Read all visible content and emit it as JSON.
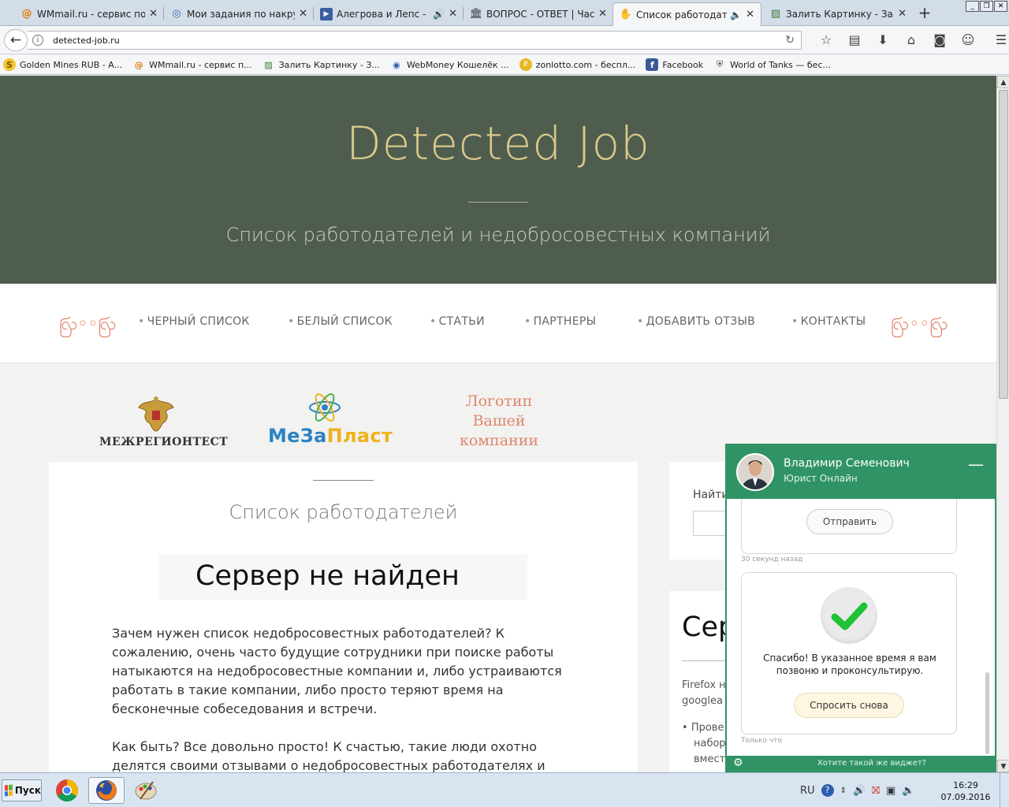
{
  "browser": {
    "tabs": [
      {
        "title": "WMmail.ru - сервис почт...",
        "icon": "at-icon"
      },
      {
        "title": "Мои задания по накрутке",
        "icon": "spiral-icon"
      },
      {
        "title": "Алегрова и Лепс - Я...",
        "icon": "play-icon"
      },
      {
        "title": "ВОПРОС - ОТВЕТ | Част...",
        "icon": "building-icon"
      },
      {
        "title": "Список работодате...",
        "icon": "hand-icon"
      },
      {
        "title": "Залить Картинку - Загр...",
        "icon": "image-icon"
      }
    ],
    "new_tab": "+",
    "url": "detected-job.ru",
    "bookmarks": [
      {
        "label": "Golden Mines RUB - A..."
      },
      {
        "label": "WMmail.ru - сервис п..."
      },
      {
        "label": "Залить Картинку - З..."
      },
      {
        "label": "WebMoney Кошелёк ..."
      },
      {
        "label": "zonlotto.com - беспл..."
      },
      {
        "label": "Facebook"
      },
      {
        "label": "World of Tanks — бес..."
      }
    ]
  },
  "site": {
    "title": "Detected Job",
    "tagline": "Список работодателей и недобросовестных компаний",
    "nav": [
      "ЧЕРНЫЙ СПИСОК",
      "БЕЛЫЙ СПИСОК",
      "СТАТЬИ",
      "ПАРТНЕРЫ",
      "ДОБАВИТЬ ОТЗЫВ",
      "КОНТАКТЫ"
    ],
    "partners": {
      "p1": "МЕЖРЕГИОНТЕСТ",
      "p2a": "МеЗа",
      "p2b": "Пласт",
      "p3": "Логотип Вашей компании"
    },
    "content": {
      "title": "Список работодателей",
      "error_box": "Сервер не найден",
      "para1": "Зачем нужен список недобросовестных работодателей? К сожалению, очень часто будущие сотрудники при поиске работы натыкаются на недобросовестные компании и, либо устраиваются работать в такие компании, либо просто теряют время на бесконечные собеседования и встречи.",
      "para2": "Как быть? Все довольно просто! К счастью, такие люди охотно делятся своими отзывами о недобросовестных работодателях и предостерегают"
    },
    "sidebar": {
      "search_label": "Найти",
      "big_text": "Сер",
      "firefox_text": "Firefox н",
      "google_text": "googlea",
      "bullet1": "Прове",
      "bullet2": "набор",
      "bullet3": "вмест"
    }
  },
  "chat": {
    "name": "Владимир Семенович",
    "role": "Юрист Онлайн",
    "send_button": "Отправить",
    "ts1": "30 секунд назад",
    "thanks": "Спасибо! В указанное время я вам позвоню и проконсультирую.",
    "ask_again": "Спросить снова",
    "ts2": "Только что",
    "footer": "Хотите такой же виджет?",
    "accent": "#2f9365"
  },
  "taskbar": {
    "start": "Пуск",
    "lang": "RU",
    "time": "16:29",
    "date": "07.09.2016"
  }
}
